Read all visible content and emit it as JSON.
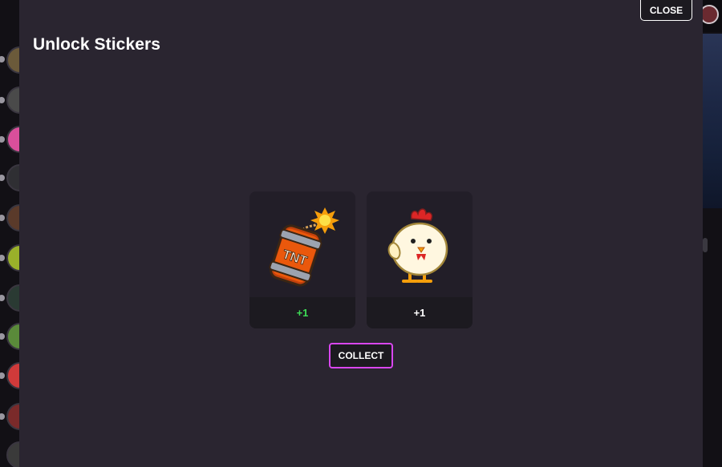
{
  "modal": {
    "title": "Unlock Stickers",
    "close_label": "CLOSE",
    "collect_label": "COLLECT"
  },
  "stickers": [
    {
      "icon": "tnt-barrel-sticker",
      "count": "+1",
      "count_color": "#3ddc55"
    },
    {
      "icon": "chick-sticker",
      "count": "+1",
      "count_color": "#ffffff"
    }
  ],
  "colors": {
    "modal_bg": "#2a2530",
    "accent": "#d946ef"
  }
}
